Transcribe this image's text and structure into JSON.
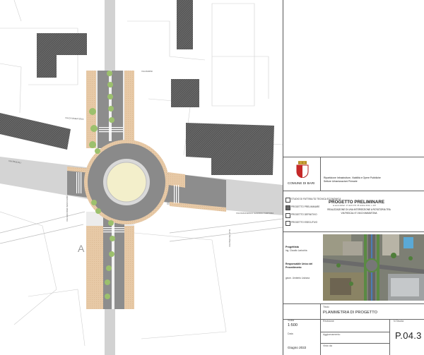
{
  "drawing": {
    "street_labels": [
      "VIA PASCALI",
      "VIA DI MAMATONA",
      "VIA MARINI",
      "VIA GIACOMO MACCARIO",
      "VIA FRANCESCO SANDRO TORTORA",
      "VIA PIER DE VITO"
    ],
    "stopline_code": "A"
  },
  "title_block": {
    "logo_caption": "COMUNE DI BARI",
    "department_lines": [
      "Ripartizione Infrastrutture, Viabilità e Opere Pubbliche",
      "Settore Urbanizzazioni Primarie"
    ],
    "project_phase": "PROGETTO PRELIMINARE",
    "phase_note": "ai sensi dell'art. 17 del D.P.R. 05 ottobre 2010, n. 207",
    "project_title": "REALIZZAZIONE DI UNA INTERSEZIONE A ROTATORIA TRA VIA PASCALI E VIA DI MAMATONA",
    "phases": [
      {
        "label": "STUDIO DI FATTIBILITÀ TECNICA ECONOMICA",
        "checked": false
      },
      {
        "label": "PROGETTO PRELIMINARE",
        "checked": true
      },
      {
        "label": "PROGETTO DEFINITIVO",
        "checked": false
      },
      {
        "label": "PROGETTO ESECUTIVO",
        "checked": false
      }
    ],
    "designer_label": "Progettista",
    "designer_name": "ing. Claudio Laricchia",
    "manager_label": "Responsabile Unico del Procedimento",
    "manager_name": "geom. Umberto Lisbona",
    "title_label": "Titolo",
    "drawing_title": "PLANIMETRIA DI PROGETTO",
    "scale_label": "Scala",
    "scale_value": "1:500",
    "revision_label": "Revisione",
    "sheet_label": "N.Tavola",
    "sheet_number": "P.04.3",
    "date_label": "Data",
    "date_value": "Giugno 2022",
    "update_label": "Aggiornamento",
    "visto_label": "Visto da"
  }
}
